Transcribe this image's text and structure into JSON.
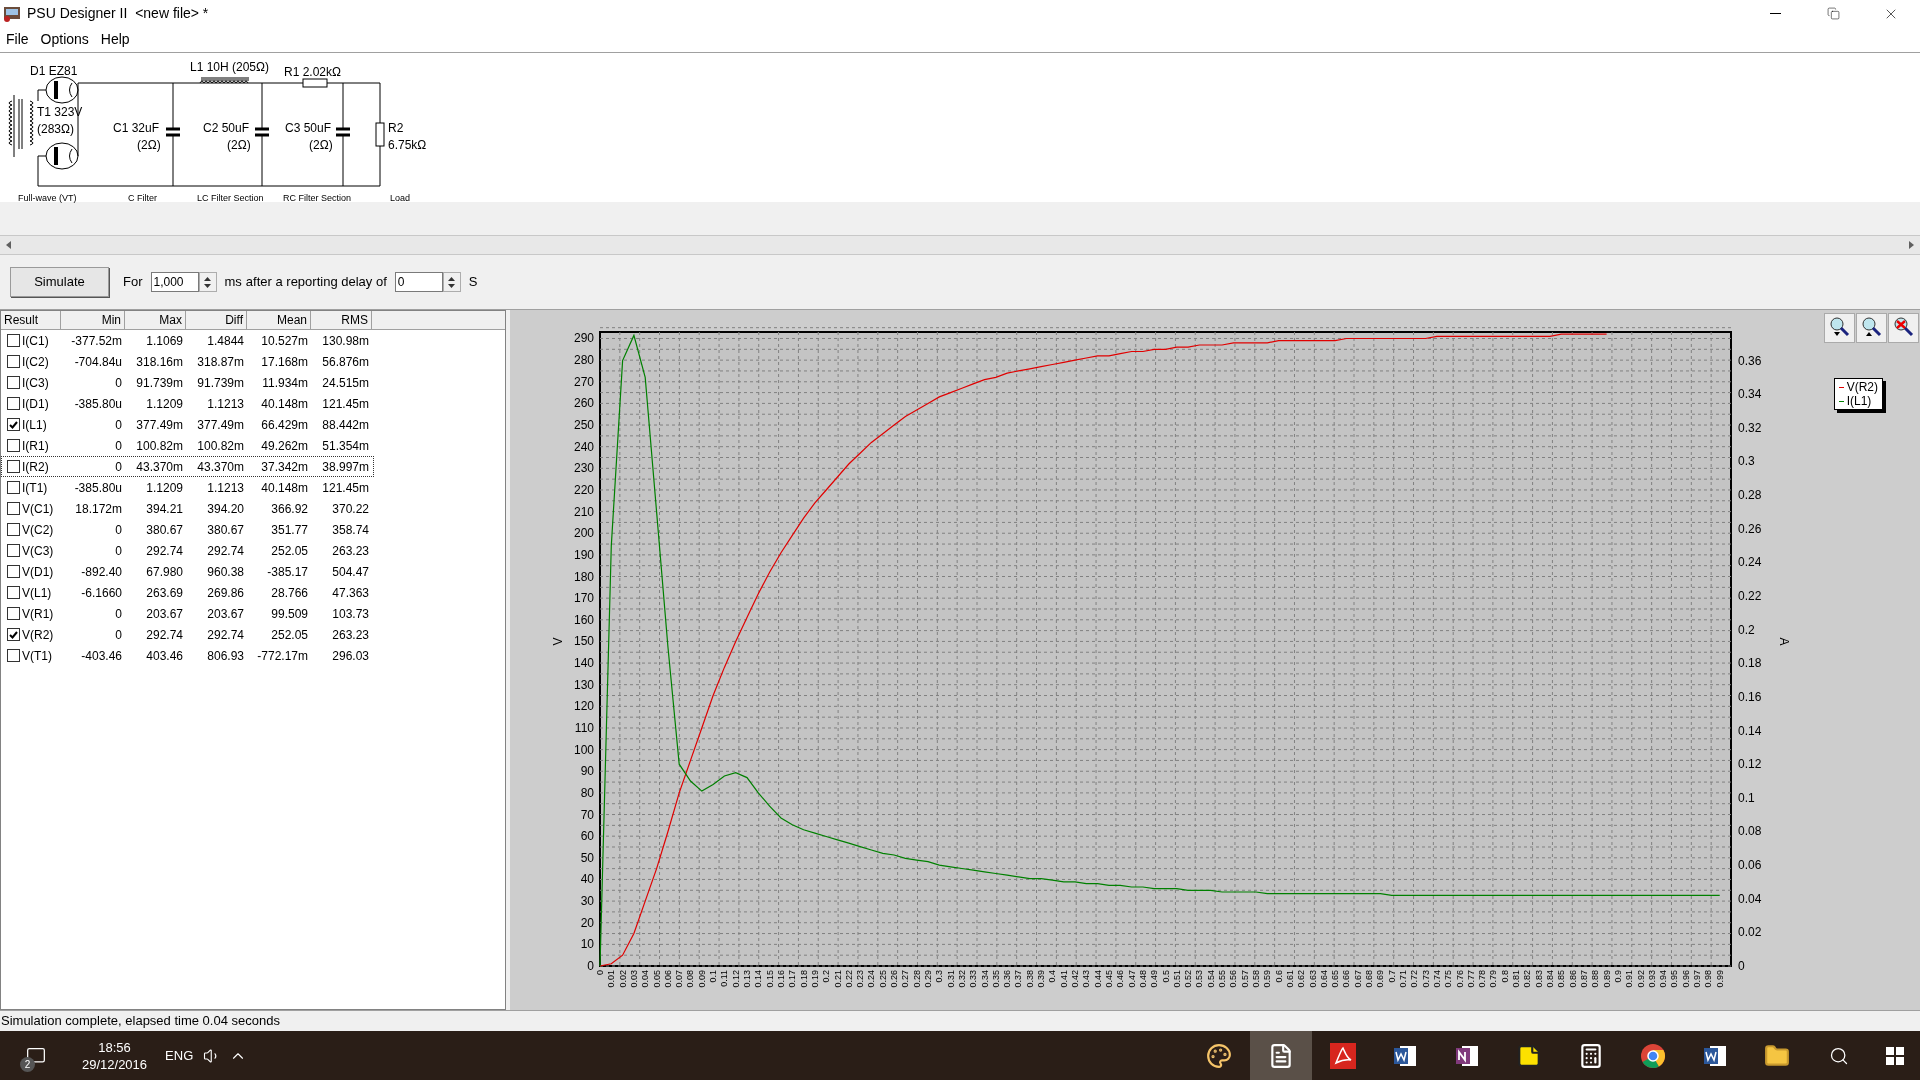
{
  "window": {
    "title": "PSU Designer II  <new file> *"
  },
  "menu": [
    "File",
    "Options",
    "Help"
  ],
  "schematic": {
    "diode": "D1 EZ81",
    "transformer": [
      "T1 323V",
      "(283Ω)"
    ],
    "inductor": "L1 10H (205Ω)",
    "resistor": "R1 2.02kΩ",
    "capacitors": [
      [
        "C1 32uF",
        "(2Ω)"
      ],
      [
        "C2 50uF",
        "(2Ω)"
      ],
      [
        "C3 50uF",
        "(2Ω)"
      ]
    ],
    "load": [
      "R2",
      "6.75kΩ"
    ],
    "sections": [
      "Full-wave (VT)",
      "C Filter",
      "LC Filter Section",
      "RC Filter Section",
      "Load"
    ]
  },
  "toolbar": {
    "button": "Simulate",
    "for_label": "For",
    "duration": "1,000",
    "duration_unit": "ms",
    "delay_label": "after a reporting delay of",
    "delay": "0",
    "delay_unit": "S"
  },
  "results": {
    "columns": [
      "Result",
      "Min",
      "Max",
      "Diff",
      "Mean",
      "RMS"
    ],
    "rows": [
      {
        "checked": false,
        "focused": false,
        "cells": [
          "I(C1)",
          "-377.52m",
          "1.1069",
          "1.4844",
          "10.527m",
          "130.98m"
        ]
      },
      {
        "checked": false,
        "focused": false,
        "cells": [
          "I(C2)",
          "-704.84u",
          "318.16m",
          "318.87m",
          "17.168m",
          "56.876m"
        ]
      },
      {
        "checked": false,
        "focused": false,
        "cells": [
          "I(C3)",
          "0",
          "91.739m",
          "91.739m",
          "11.934m",
          "24.515m"
        ]
      },
      {
        "checked": false,
        "focused": false,
        "cells": [
          "I(D1)",
          "-385.80u",
          "1.1209",
          "1.1213",
          "40.148m",
          "121.45m"
        ]
      },
      {
        "checked": true,
        "focused": false,
        "cells": [
          "I(L1)",
          "0",
          "377.49m",
          "377.49m",
          "66.429m",
          "88.442m"
        ]
      },
      {
        "checked": false,
        "focused": false,
        "cells": [
          "I(R1)",
          "0",
          "100.82m",
          "100.82m",
          "49.262m",
          "51.354m"
        ]
      },
      {
        "checked": false,
        "focused": true,
        "cells": [
          "I(R2)",
          "0",
          "43.370m",
          "43.370m",
          "37.342m",
          "38.997m"
        ]
      },
      {
        "checked": false,
        "focused": false,
        "cells": [
          "I(T1)",
          "-385.80u",
          "1.1209",
          "1.1213",
          "40.148m",
          "121.45m"
        ]
      },
      {
        "checked": false,
        "focused": false,
        "cells": [
          "V(C1)",
          "18.172m",
          "394.21",
          "394.20",
          "366.92",
          "370.22"
        ]
      },
      {
        "checked": false,
        "focused": false,
        "cells": [
          "V(C2)",
          "0",
          "380.67",
          "380.67",
          "351.77",
          "358.74"
        ]
      },
      {
        "checked": false,
        "focused": false,
        "cells": [
          "V(C3)",
          "0",
          "292.74",
          "292.74",
          "252.05",
          "263.23"
        ]
      },
      {
        "checked": false,
        "focused": false,
        "cells": [
          "V(D1)",
          "-892.40",
          "67.980",
          "960.38",
          "-385.17",
          "504.47"
        ]
      },
      {
        "checked": false,
        "focused": false,
        "cells": [
          "V(L1)",
          "-6.1660",
          "263.69",
          "269.86",
          "28.766",
          "47.363"
        ]
      },
      {
        "checked": false,
        "focused": false,
        "cells": [
          "V(R1)",
          "0",
          "203.67",
          "203.67",
          "99.509",
          "103.73"
        ]
      },
      {
        "checked": true,
        "focused": false,
        "cells": [
          "V(R2)",
          "0",
          "292.74",
          "292.74",
          "252.05",
          "263.23"
        ]
      },
      {
        "checked": false,
        "focused": false,
        "cells": [
          "V(T1)",
          "-403.46",
          "403.46",
          "806.93",
          "-772.17m",
          "296.03"
        ]
      }
    ]
  },
  "chart": {
    "chart_data": {
      "type": "line",
      "grid": true,
      "ylabel": "V",
      "y2label": "A",
      "xlim": [
        0,
        1.0
      ],
      "ylim": [
        0,
        293
      ],
      "y2lim": [
        0,
        0.377
      ],
      "x": [
        0,
        0.01,
        0.02,
        0.03,
        0.04,
        0.05,
        0.06,
        0.07,
        0.08,
        0.09,
        0.1,
        0.11,
        0.12,
        0.13,
        0.14,
        0.15,
        0.16,
        0.17,
        0.18,
        0.19,
        0.2,
        0.21,
        0.22,
        0.23,
        0.24,
        0.25,
        0.26,
        0.27,
        0.28,
        0.29,
        0.3,
        0.31,
        0.32,
        0.33,
        0.34,
        0.35,
        0.36,
        0.37,
        0.38,
        0.39,
        0.4,
        0.41,
        0.42,
        0.43,
        0.44,
        0.45,
        0.46,
        0.47,
        0.48,
        0.49,
        0.5,
        0.51,
        0.52,
        0.53,
        0.54,
        0.55,
        0.56,
        0.57,
        0.58,
        0.59,
        0.6,
        0.61,
        0.62,
        0.63,
        0.64,
        0.65,
        0.66,
        0.67,
        0.68,
        0.69,
        0.7,
        0.71,
        0.72,
        0.73,
        0.74,
        0.75,
        0.76,
        0.77,
        0.78,
        0.79,
        0.8,
        0.81,
        0.82,
        0.83,
        0.84,
        0.85,
        0.86,
        0.87,
        0.88,
        0.89,
        0.9,
        0.91,
        0.92,
        0.93,
        0.94,
        0.95,
        0.96,
        0.97,
        0.98,
        0.99
      ],
      "xticks": [
        0,
        0.01,
        0.02,
        0.03,
        0.04,
        0.05,
        0.06,
        0.07,
        0.08,
        0.09,
        0.1,
        0.11,
        0.12,
        0.13,
        0.14,
        0.15,
        0.16,
        0.17,
        0.18,
        0.19,
        0.2,
        0.21,
        0.22,
        0.23,
        0.24,
        0.25,
        0.26,
        0.27,
        0.28,
        0.29,
        0.3,
        0.31,
        0.32,
        0.33,
        0.34,
        0.35,
        0.36,
        0.37,
        0.38,
        0.39,
        0.4,
        0.41,
        0.42,
        0.43,
        0.44,
        0.45,
        0.46,
        0.47,
        0.48,
        0.49,
        0.5,
        0.51,
        0.52,
        0.53,
        0.54,
        0.55,
        0.56,
        0.57,
        0.58,
        0.59,
        0.6,
        0.61,
        0.62,
        0.63,
        0.64,
        0.65,
        0.66,
        0.67,
        0.68,
        0.69,
        0.7,
        0.71,
        0.72,
        0.73,
        0.74,
        0.75,
        0.76,
        0.77,
        0.78,
        0.79,
        0.8,
        0.81,
        0.82,
        0.83,
        0.84,
        0.85,
        0.86,
        0.87,
        0.88,
        0.89,
        0.9,
        0.91,
        0.92,
        0.93,
        0.94,
        0.95,
        0.96,
        0.97,
        0.98,
        0.99
      ],
      "yticks": [
        0,
        10,
        20,
        30,
        40,
        50,
        60,
        70,
        80,
        90,
        100,
        110,
        120,
        130,
        140,
        150,
        160,
        170,
        180,
        190,
        200,
        210,
        220,
        230,
        240,
        250,
        260,
        270,
        280,
        290
      ],
      "y2ticks": [
        0,
        0.02,
        0.04,
        0.06,
        0.08,
        0.1,
        0.12,
        0.14,
        0.16,
        0.18,
        0.2,
        0.22,
        0.24,
        0.26,
        0.28,
        0.3,
        0.32,
        0.34,
        0.36
      ],
      "series": [
        {
          "name": "V(R2)",
          "color": "#e00000",
          "axis": "y",
          "values": [
            0,
            1,
            5,
            15,
            30,
            45,
            62,
            80,
            95,
            110,
            125,
            138,
            150,
            161,
            172,
            182,
            191,
            199,
            207,
            214,
            220,
            226,
            232,
            237,
            242,
            246,
            250,
            254,
            257,
            260,
            263,
            265,
            267,
            269,
            271,
            272,
            274,
            275,
            276,
            277,
            278,
            279,
            280,
            281,
            282,
            282,
            283,
            284,
            284,
            285,
            285,
            286,
            286,
            287,
            287,
            287,
            288,
            288,
            288,
            288,
            289,
            289,
            289,
            289,
            289,
            289,
            290,
            290,
            290,
            290,
            290,
            290,
            290,
            290,
            291,
            291,
            291,
            291,
            291,
            291,
            291,
            291,
            291,
            291,
            291,
            292,
            292,
            292,
            292,
            292,
            null,
            null,
            null,
            null,
            null,
            null,
            null,
            null,
            null,
            null
          ]
        },
        {
          "name": "I(L1)",
          "color": "#008000",
          "axis": "y2",
          "values": [
            0,
            0.25,
            0.36,
            0.375,
            0.35,
            0.27,
            0.19,
            0.12,
            0.11,
            0.104,
            0.108,
            0.113,
            0.115,
            0.112,
            0.103,
            0.095,
            0.088,
            0.084,
            0.081,
            0.079,
            0.077,
            0.075,
            0.073,
            0.071,
            0.069,
            0.067,
            0.066,
            0.064,
            0.063,
            0.062,
            0.06,
            0.059,
            0.058,
            0.057,
            0.056,
            0.055,
            0.054,
            0.053,
            0.052,
            0.052,
            0.051,
            0.05,
            0.05,
            0.049,
            0.049,
            0.048,
            0.048,
            0.047,
            0.047,
            0.046,
            0.046,
            0.046,
            0.045,
            0.045,
            0.045,
            0.044,
            0.044,
            0.044,
            0.044,
            0.043,
            0.043,
            0.043,
            0.043,
            0.043,
            0.043,
            0.043,
            0.043,
            0.043,
            0.043,
            0.043,
            0.042,
            0.042,
            0.042,
            0.042,
            0.042,
            0.042,
            0.042,
            0.042,
            0.042,
            0.042,
            0.042,
            0.042,
            0.042,
            0.042,
            0.042,
            0.042,
            0.042,
            0.042,
            0.042,
            0.042,
            0.042,
            0.042,
            0.042,
            0.042,
            0.042,
            0.042,
            0.042,
            0.042,
            0.042,
            0.042
          ]
        }
      ]
    }
  },
  "status_bar": "Simulation complete, elapsed time 0.04 seconds",
  "taskbar": {
    "notifications": "2",
    "time": "18:56",
    "date": "29/12/2016",
    "language": "ENG",
    "apps": [
      {
        "kind": "paint",
        "selected": false
      },
      {
        "kind": "document",
        "selected": true
      },
      {
        "kind": "pdf",
        "selected": false
      },
      {
        "kind": "word",
        "selected": false
      },
      {
        "kind": "onenote",
        "selected": false
      },
      {
        "kind": "notes",
        "selected": false
      },
      {
        "kind": "calculator",
        "selected": false
      },
      {
        "kind": "browser",
        "selected": false
      },
      {
        "kind": "word",
        "selected": false
      },
      {
        "kind": "folder",
        "selected": false
      }
    ]
  }
}
